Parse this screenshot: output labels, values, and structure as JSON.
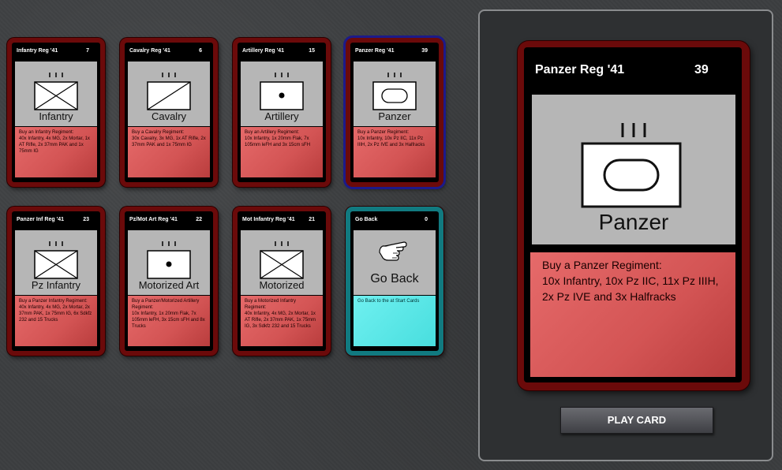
{
  "cards": [
    {
      "name": "Infantry Reg '41",
      "cost": "7",
      "label": "Infantry",
      "desc": "Buy an Infantry Regiment:\n40x Infantry, 4x MG, 2x Mortar, 1x AT Rifle, 2x 37mm PAK and 1x 75mm IG"
    },
    {
      "name": "Cavalry Reg '41",
      "cost": "6",
      "label": "Cavalry",
      "desc": "Buy a Cavalry Regiment:\n30x Cavalry, 3x MG, 1x AT Rifle, 2x 37mm PAK and 1x 75mm IG"
    },
    {
      "name": "Artillery Reg '41",
      "cost": "15",
      "label": "Artillery",
      "desc": "Buy an Artillery Regiment:\n10x Infantry, 1x 20mm Flak, 7x 105mm leFH and 3x 15cm sFH"
    },
    {
      "name": "Panzer Reg '41",
      "cost": "39",
      "label": "Panzer",
      "desc": "Buy a Panzer Regiment:\n10x Infantry, 10x Pz IIC, 11x Pz IIIH, 2x Pz IVE and 3x Halfracks"
    },
    {
      "name": "Panzer Inf Reg '41",
      "cost": "23",
      "label": "Pz Infantry",
      "desc": "Buy a Panzer Infantry Regiment:\n40x Infantry, 4x MG, 2x Mortar, 2x 37mm PAK, 1x 75mm IG, 6x Sdkfz 232 and 15 Trucks"
    },
    {
      "name": "Pz/Mot Art Reg '41",
      "cost": "22",
      "label": "Motorized Art",
      "desc": "Buy a Panzer/Motorized Artillery Regiment:\n10x Infantry, 1x 20mm Flak, 7x 105mm leFH, 3x 15cm sFH and 8x Trucks"
    },
    {
      "name": "Mot Infantry Reg '41",
      "cost": "21",
      "label": "Motorized",
      "desc": "Buy a Motorized Infantry Regiment:\n40x Infantry, 4x MG, 2x Mortar, 1x AT Rifle, 2x 37mm PAK, 1x 75mm IG, 3x Sdkfz 232 and 15 Trucks"
    },
    {
      "name": "Go Back",
      "cost": "0",
      "label": "Go Back",
      "desc": "Go Back to the at Start Cards"
    }
  ],
  "detail": {
    "name": "Panzer Reg '41",
    "cost": "39",
    "label": "Panzer",
    "desc_title": "Buy a Panzer Regiment:",
    "desc_body": "10x Infantry, 10x Pz IIC, 11x Pz IIIH, 2x Pz IVE and 3x Halfracks"
  },
  "play_button": "PLAY CARD"
}
